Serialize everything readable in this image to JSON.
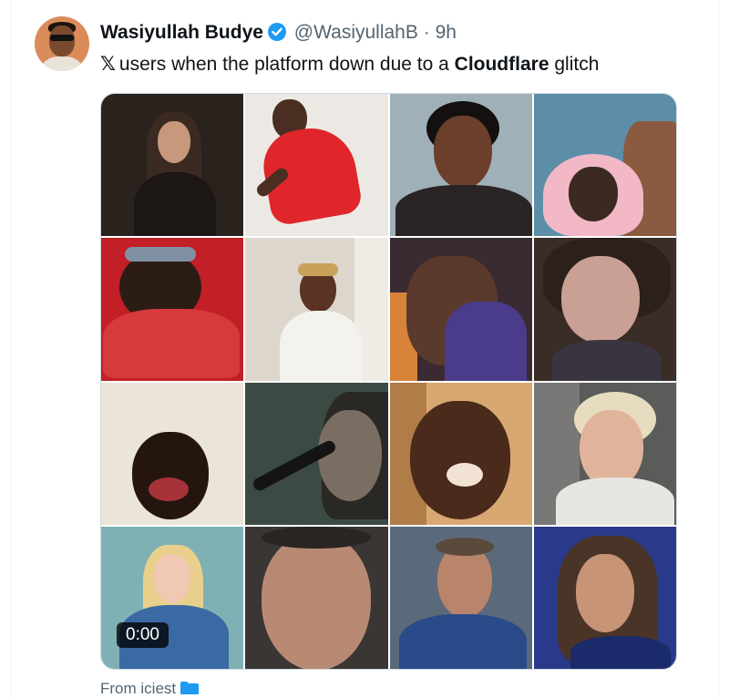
{
  "tweet": {
    "author_name": "Wasiyullah Budye",
    "handle": "@WasiyullahB",
    "separator": "·",
    "time": "9h",
    "text_prefix": "𝕏",
    "text_before": "users when the platform down due to a",
    "text_bold": "Cloudflare",
    "text_after": "glitch",
    "media_duration": "0:00",
    "footer_text": "From iciest"
  },
  "icons": {
    "verified": "verified-badge-icon",
    "folder": "folder-icon"
  },
  "colors": {
    "verified_blue": "#1d9bf0",
    "secondary_text": "#536471"
  }
}
